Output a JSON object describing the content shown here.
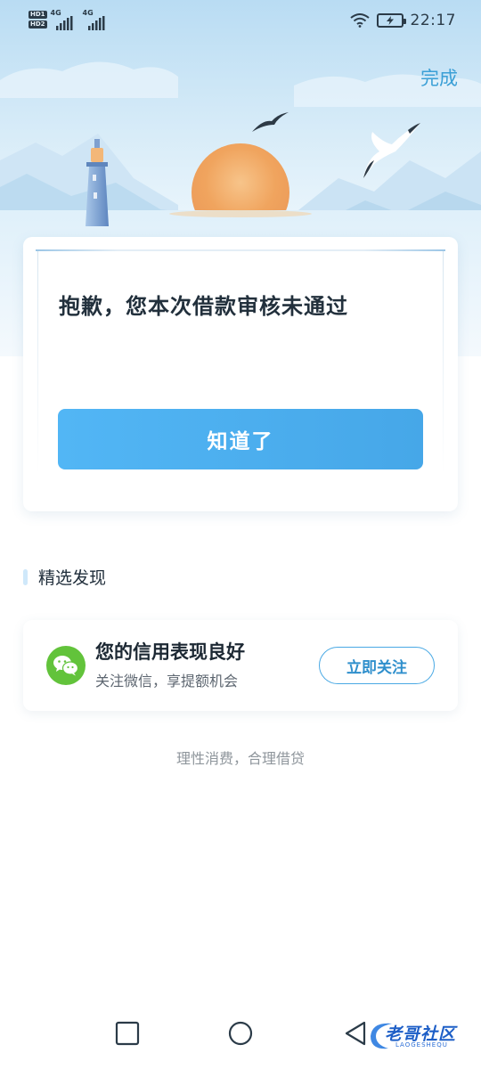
{
  "status_bar": {
    "sim1_tag": "HD1",
    "sim2_tag": "HD2",
    "sim1_network": "4G",
    "sim2_network": "4G",
    "time": "22:17"
  },
  "header": {
    "done_label": "完成"
  },
  "result": {
    "title": "抱歉，您本次借款审核未通过",
    "ack_button_label": "知道了"
  },
  "discover": {
    "section_title": "精选发现",
    "promo": {
      "title": "您的信用表现良好",
      "subtitle": "关注微信，享提额机会",
      "button_label": "立即关注"
    }
  },
  "footer": {
    "slogan": "理性消费，合理借贷"
  },
  "watermark": {
    "text": "老哥社区",
    "sub": "LAOGESHEQU"
  },
  "colors": {
    "accent": "#4aa9e4",
    "button_gradient_start": "#52b6f5",
    "button_gradient_end": "#46a7e8",
    "sun": "#f0a45e",
    "wechat_green": "#62c33b"
  }
}
